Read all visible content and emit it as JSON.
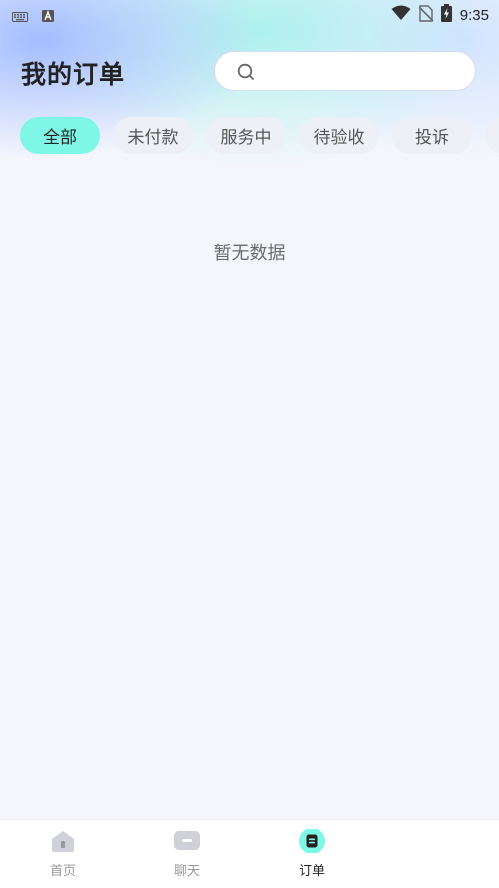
{
  "status_bar": {
    "time": "9:35",
    "icons": [
      "keyboard-icon",
      "a-letter-icon",
      "wifi-icon",
      "no-sim-icon",
      "battery-charging-icon"
    ]
  },
  "header": {
    "title": "我的订单",
    "search_placeholder": ""
  },
  "tabs": [
    {
      "label": "全部",
      "active": true
    },
    {
      "label": "未付款",
      "active": false
    },
    {
      "label": "服务中",
      "active": false
    },
    {
      "label": "待验收",
      "active": false
    },
    {
      "label": "投诉",
      "active": false
    }
  ],
  "empty_state": {
    "text": "暂无数据"
  },
  "bottom_nav": [
    {
      "label": "首页",
      "icon": "home-icon",
      "active": false
    },
    {
      "label": "聊天",
      "icon": "chat-icon",
      "active": false
    },
    {
      "label": "订单",
      "icon": "order-icon",
      "active": true
    }
  ],
  "colors": {
    "accent": "#7ef7e7",
    "tab_bg": "#eef0f7",
    "page_bg": "#f5f6fc"
  }
}
